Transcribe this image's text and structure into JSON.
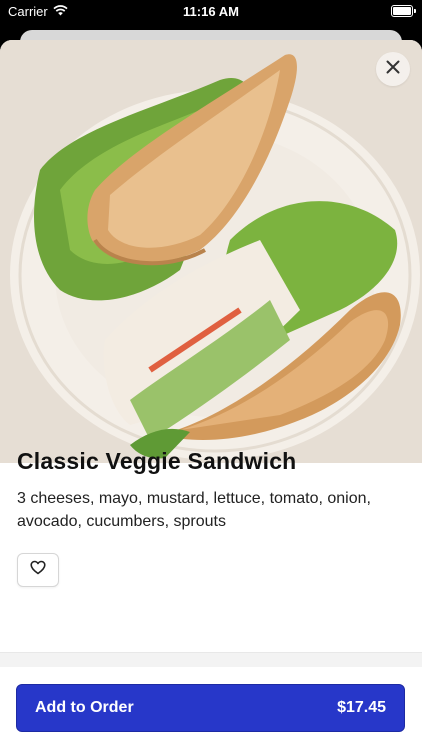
{
  "status_bar": {
    "carrier": "Carrier",
    "time": "11:16 AM",
    "wifi_icon": "wifi-icon",
    "battery_icon": "battery-icon"
  },
  "item": {
    "image_alt": "sandwich-photo",
    "title": "Classic Veggie Sandwich",
    "description": "3 cheeses, mayo, mustard, lettuce, tomato, onion, avocado, cucumbers, sprouts"
  },
  "actions": {
    "close_icon": "close-icon",
    "favorite_icon": "heart-icon",
    "add_label": "Add to Order",
    "price": "$17.45"
  },
  "colors": {
    "accent": "#2737c9"
  }
}
